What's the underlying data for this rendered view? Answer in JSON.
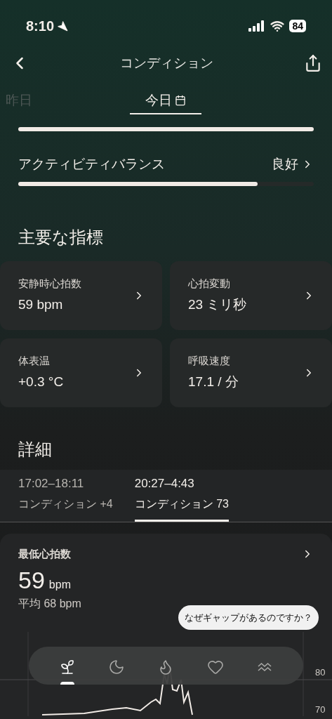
{
  "status_bar": {
    "time": "8:10",
    "battery": "84"
  },
  "nav": {
    "title": "コンディション"
  },
  "date_tabs": [
    {
      "label": "昨日",
      "selected": false
    },
    {
      "label": "今日",
      "selected": true
    }
  ],
  "scores": [
    {
      "level": 1
    },
    {
      "label": "アクティビティバランス",
      "value": "良好",
      "level": 0.81
    }
  ],
  "key_metrics": {
    "title": "主要な指標",
    "cards": [
      {
        "label": "安静時心拍数",
        "value": "59 bpm"
      },
      {
        "label": "心拍変動",
        "value": "23 ミリ秒"
      },
      {
        "label": "体表温",
        "value": "+0.3 °C"
      },
      {
        "label": "呼吸速度",
        "value": "17.1 / 分"
      }
    ]
  },
  "details": {
    "title": "詳細",
    "sessions": [
      {
        "time": "17:02–18:11",
        "label": "コンディション +4",
        "selected": false
      },
      {
        "time": "20:27–4:43",
        "label": "コンディション 73",
        "selected": true
      }
    ],
    "card": {
      "title": "最低心拍数",
      "value": "59",
      "unit": "bpm",
      "average": "平均 68 bpm",
      "tooltip": "なぜギャップがあるのですか？",
      "axis_labels": [
        "80",
        "70"
      ]
    }
  },
  "bottom_nav": [
    {
      "kind": "sprout",
      "selected": true
    },
    {
      "kind": "moon",
      "selected": false
    },
    {
      "kind": "flame",
      "selected": false
    },
    {
      "kind": "heart",
      "selected": false
    },
    {
      "kind": "waves",
      "selected": false
    }
  ]
}
